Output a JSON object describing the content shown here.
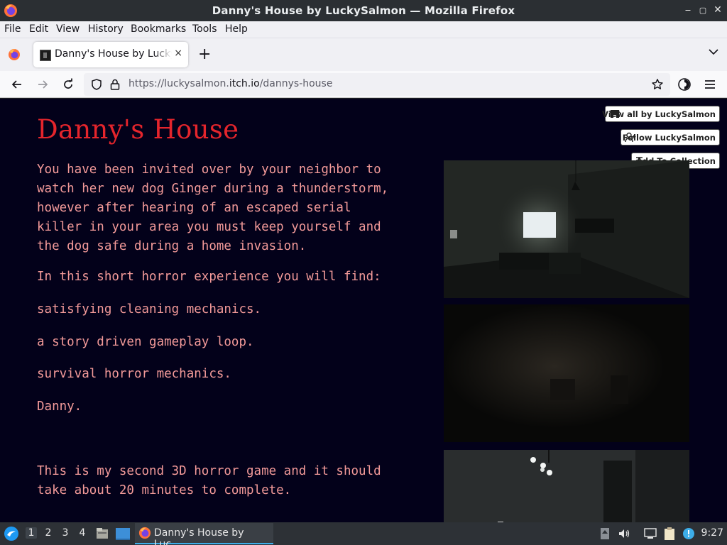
{
  "window": {
    "title": "Danny's House by LuckySalmon — Mozilla Firefox",
    "controls": [
      "minimize",
      "maximize",
      "close"
    ]
  },
  "menubar": {
    "items": [
      "File",
      "Edit",
      "View",
      "History",
      "Bookmarks",
      "Tools",
      "Help"
    ]
  },
  "tabs": {
    "active": {
      "title": "Danny's House by LuckySalmon",
      "close": "×"
    },
    "new_tab": "+"
  },
  "navbar": {
    "url_prefix": "https://luckysalmon.",
    "url_domain": "itch.io",
    "url_path": "/dannys-house"
  },
  "page": {
    "title": "Danny's House",
    "paragraphs": [
      "You have been invited over by your neighbor to\nwatch her new dog Ginger during a thunderstorm,\nhowever after hearing of an escaped serial\nkiller in your area you must keep yourself and\nthe dog safe during a home invasion.",
      "In this short horror experience you will find:",
      "satisfying cleaning mechanics.",
      "a story driven gameplay loop.",
      "survival horror mechanics.",
      "Danny.",
      "This is my second 3D horror game and it should\ntake about 20 minutes to complete."
    ],
    "buttons": {
      "view_all": "View all by LuckySalmon",
      "follow": "Follow LuckySalmon",
      "add_collection": "Add To Collection"
    },
    "colors": {
      "background": "#03011a",
      "title": "#e5252c",
      "text": "#f39a99"
    }
  },
  "taskbar": {
    "workspaces": [
      "1",
      "2",
      "3",
      "4"
    ],
    "active_workspace": "1",
    "task_label": "Danny's House by Luc...",
    "clock": "9:27",
    "tray_icons": [
      "updates-icon",
      "volume-icon",
      "network-icon",
      "clipboard-icon",
      "notification-icon"
    ]
  }
}
